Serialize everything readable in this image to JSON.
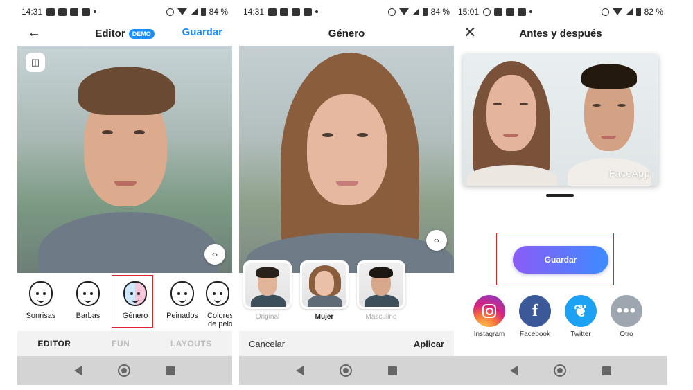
{
  "colors": {
    "accent_blue": "#1a8cff",
    "highlight_red": "#e0222b",
    "save_gradient_start": "#8a5cf6",
    "save_gradient_end": "#3d8bff"
  },
  "screen1": {
    "status": {
      "time": "14:31",
      "battery": "84 %"
    },
    "header": {
      "back_icon": "arrow-left-icon",
      "title": "Editor",
      "badge": "DEMO",
      "save": "Guardar"
    },
    "compare_icon": "split-compare-icon",
    "swipe_icon": "swipe-compare-icon",
    "filters": [
      {
        "label": "Sonrisas",
        "icon": "smile-face-icon"
      },
      {
        "label": "Barbas",
        "icon": "beard-face-icon"
      },
      {
        "label": "Género",
        "icon": "gender-face-icon",
        "highlighted": true
      },
      {
        "label": "Peinados",
        "icon": "hairstyle-face-icon"
      },
      {
        "label": "Colores de pelo",
        "icon": "haircolor-face-icon"
      }
    ],
    "tabs": [
      {
        "label": "EDITOR",
        "active": true
      },
      {
        "label": "FUN",
        "active": false
      },
      {
        "label": "LAYOUTS",
        "active": false
      }
    ]
  },
  "screen2": {
    "status": {
      "time": "14:31",
      "battery": "84 %"
    },
    "header": {
      "title": "Género"
    },
    "swipe_icon": "swipe-compare-icon",
    "variants": [
      {
        "label": "Original",
        "active": false
      },
      {
        "label": "Mujer",
        "active": true
      },
      {
        "label": "Masculino",
        "active": false
      }
    ],
    "actions": {
      "cancel": "Cancelar",
      "apply": "Aplicar"
    }
  },
  "screen3": {
    "status": {
      "time": "15:01",
      "battery": "82 %"
    },
    "header": {
      "close_icon": "close-icon",
      "title": "Antes y después"
    },
    "watermark": "FaceApp",
    "save_button": "Guardar",
    "share": [
      {
        "label": "Instagram",
        "icon": "instagram-icon"
      },
      {
        "label": "Facebook",
        "icon": "facebook-icon"
      },
      {
        "label": "Twitter",
        "icon": "twitter-icon"
      },
      {
        "label": "Otro",
        "icon": "more-icon"
      }
    ]
  }
}
